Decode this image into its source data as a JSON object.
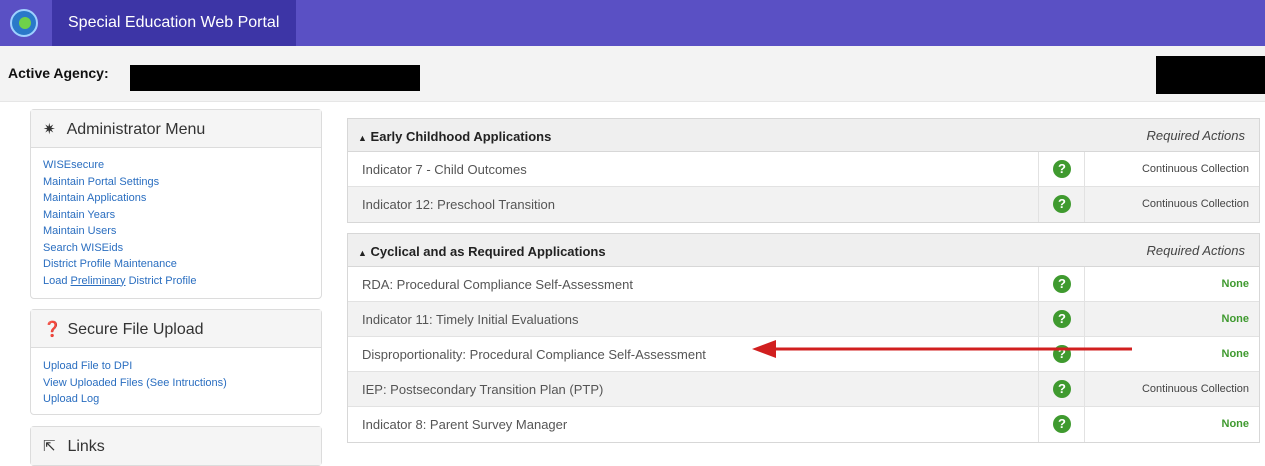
{
  "header": {
    "title": "Special Education Web Portal"
  },
  "agency": {
    "label": "Active Agency:"
  },
  "admin_menu": {
    "title": "Administrator Menu",
    "links": [
      "WISEsecure",
      "Maintain Portal Settings",
      "Maintain Applications",
      "Maintain Years",
      "Maintain Users",
      "Search WISEids",
      "District Profile Maintenance"
    ],
    "last_link": {
      "pre": "Load ",
      "underlined": "Preliminary",
      "post": " District Profile"
    }
  },
  "file_upload": {
    "title": "Secure File Upload",
    "links": [
      "Upload File to DPI",
      "View Uploaded Files (See Intructions)",
      "Upload Log"
    ]
  },
  "links_panel": {
    "title": "Links"
  },
  "early_childhood": {
    "title": "Early Childhood Applications",
    "actions_header": "Required Actions",
    "rows": [
      {
        "name": "Indicator 7 - Child Outcomes",
        "status": "Continuous Collection"
      },
      {
        "name": "Indicator 12: Preschool Transition",
        "status": "Continuous Collection"
      }
    ]
  },
  "cyclical": {
    "title": "Cyclical and as Required Applications",
    "actions_header": "Required Actions",
    "rows": [
      {
        "name": "RDA: Procedural Compliance Self-Assessment",
        "status": "None"
      },
      {
        "name": "Indicator 11: Timely Initial Evaluations",
        "status": "None"
      },
      {
        "name": "Disproportionality: Procedural Compliance Self-Assessment",
        "status": "None"
      },
      {
        "name": "IEP: Postsecondary Transition Plan (PTP)",
        "status": "Continuous Collection"
      },
      {
        "name": "Indicator 8: Parent Survey Manager",
        "status": "None"
      }
    ]
  },
  "colors": {
    "topbar": "#5a50c4",
    "brand_tab": "#3d35a6",
    "link": "#2a6ec0",
    "success": "#3f9a2f",
    "arrow": "#d11f1f"
  },
  "icons": {
    "admin": "gear-icon",
    "upload": "question-circle-icon",
    "links": "external-link-icon",
    "help": "question-circle-icon"
  }
}
